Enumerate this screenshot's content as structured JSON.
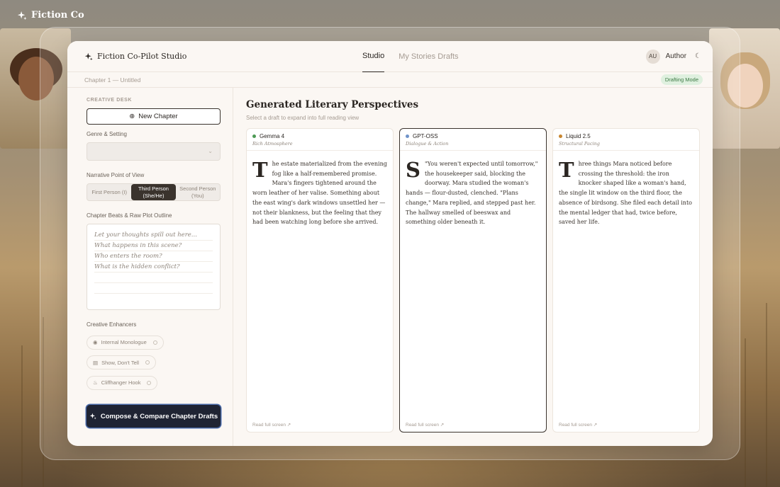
{
  "background": {
    "brand": "Fiction Co"
  },
  "window": {
    "logo_text": "Fiction Co-Pilot Studio",
    "nav": [
      {
        "label": "Studio",
        "active": true
      },
      {
        "label": "My Stories Drafts",
        "active": false
      }
    ],
    "user": {
      "initials": "AU",
      "name": "Author"
    }
  },
  "crumb": {
    "text": "Chapter 1 — Untitled",
    "mode": "Drafting Mode"
  },
  "sidebar": {
    "section_title": "CREATIVE DESK",
    "new_chapter": "New Chapter",
    "genre_label": "Genre & Setting",
    "genre_value": "",
    "pov_label": "Narrative Point of View",
    "pov_options": [
      "First Person (I)",
      "Third Person (She/He)",
      "Second Person (You)"
    ],
    "pov_selected": 1,
    "outline_label": "Chapter Beats & Raw Plot Outline",
    "outline_lines": [
      "Let your thoughts spill out here...",
      "What happens in this scene?",
      "Who enters the room?",
      "What is the hidden conflict?"
    ],
    "enhancers_label": "Creative Enhancers",
    "enhancers": [
      {
        "label": "Internal Monologue",
        "icon": "eye-icon"
      },
      {
        "label": "Show, Don't Tell",
        "icon": "film-icon"
      },
      {
        "label": "Cliffhanger Hook",
        "icon": "flame-icon"
      }
    ],
    "compose_label": "Compose & Compare Chapter Drafts"
  },
  "main": {
    "title": "Generated Literary Perspectives",
    "subtitle": "Select a draft to expand into full reading view",
    "read_full": "Read full screen ↗",
    "cards": [
      {
        "model": "Gemma 4",
        "style": "Rich Atmosphere",
        "dot_color": "#4d9a55",
        "dropcap": "T",
        "text": "he estate materialized from the evening fog like a half-remembered promise. Mara's fingers tightened around the worn leather of her valise. Something about the east wing's dark windows unsettled her — not their blankness, but the feeling that they had been watching long before she arrived.",
        "selected": false
      },
      {
        "model": "GPT-OSS",
        "style": "Dialogue & Action",
        "dot_color": "#6f93c9",
        "dropcap": "S",
        "text": "\"You weren't expected until tomorrow,\" the housekeeper said, blocking the doorway. Mara studied the woman's hands — flour-dusted, clenched. \"Plans change,\" Mara replied, and stepped past her. The hallway smelled of beeswax and something older beneath it.",
        "selected": true
      },
      {
        "model": "Liquid 2.5",
        "style": "Structural Pacing",
        "dot_color": "#c8862f",
        "dropcap": "T",
        "text": "hree things Mara noticed before crossing the threshold: the iron knocker shaped like a woman's hand, the single lit window on the third floor, the absence of birdsong. She filed each detail into the mental ledger that had, twice before, saved her life.",
        "selected": false
      }
    ]
  }
}
